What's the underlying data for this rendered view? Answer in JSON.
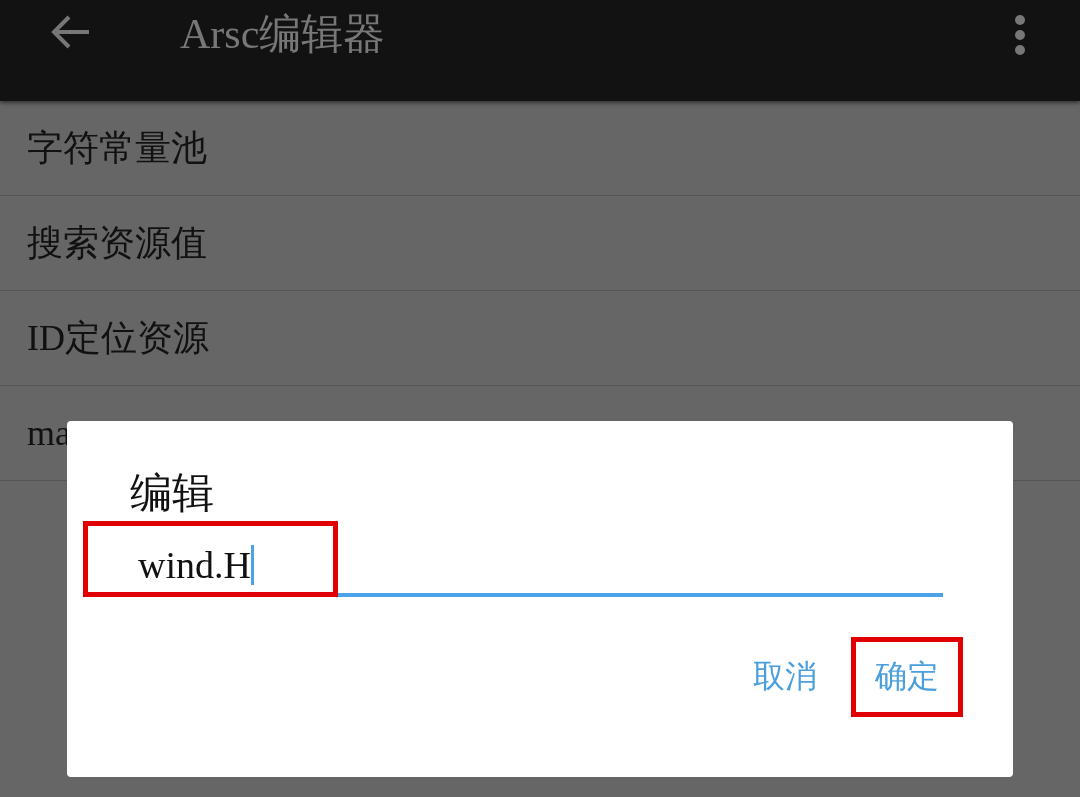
{
  "app_bar": {
    "title": "Arsc编辑器"
  },
  "items": [
    {
      "label": "字符常量池"
    },
    {
      "label": "搜索资源值"
    },
    {
      "label": "ID定位资源"
    },
    {
      "label": "ma"
    }
  ],
  "dialog": {
    "title": "编辑",
    "field": {
      "value": "wind.H"
    },
    "buttons": [
      {
        "label": "取消",
        "highlighted": false
      },
      {
        "label": "确定",
        "highlighted": true
      }
    ]
  }
}
